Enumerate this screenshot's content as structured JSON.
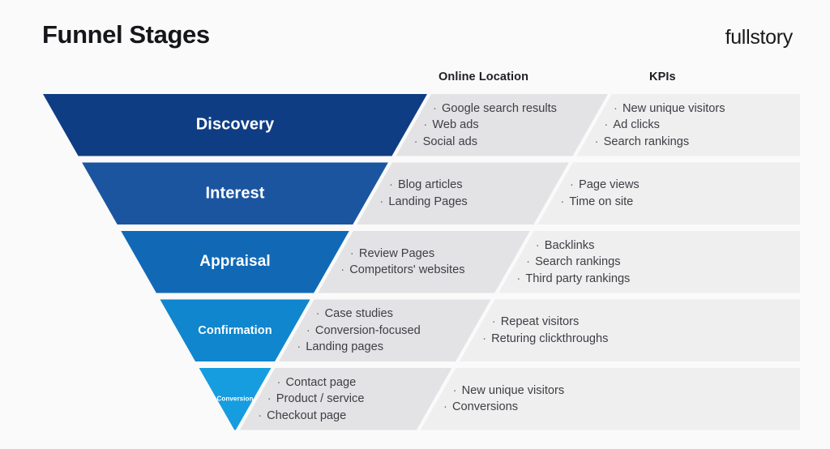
{
  "header": {
    "title": "Funnel Stages",
    "logo": "fullstory"
  },
  "columns": {
    "location_header": "Online Location",
    "kpi_header": "KPIs"
  },
  "colors": {
    "background": "#fafafa",
    "stage_1": "#0f3d84",
    "stage_2": "#1b55a0",
    "stage_3": "#1169b6",
    "stage_4": "#0f86ce",
    "stage_5": "#159de0",
    "panel_location": "#e3e3e5",
    "panel_kpi": "#efeff0",
    "text_dark": "#15161a",
    "text_body": "#3d3f44"
  },
  "rows": [
    {
      "stage": "Discovery",
      "location": [
        "Google search results",
        "Web ads",
        "Social ads"
      ],
      "kpis": [
        "New unique visitors",
        "Ad clicks",
        "Search rankings"
      ]
    },
    {
      "stage": "Interest",
      "location": [
        "Blog articles",
        "Landing Pages"
      ],
      "kpis": [
        "Page views",
        "Time on site"
      ]
    },
    {
      "stage": "Appraisal",
      "location": [
        "Review Pages",
        "Competitors' websites"
      ],
      "kpis": [
        "Backlinks",
        "Search rankings",
        "Third party rankings"
      ]
    },
    {
      "stage": "Confirmation",
      "location": [
        "Case studies",
        "Conversion-focused",
        "Landing pages"
      ],
      "kpis": [
        "Repeat visitors",
        "Returing clickthroughs"
      ]
    },
    {
      "stage": "Conversion",
      "location": [
        "Contact page",
        "Product / service",
        "Checkout page"
      ],
      "kpis": [
        "New unique visitors",
        "Conversions"
      ]
    }
  ]
}
